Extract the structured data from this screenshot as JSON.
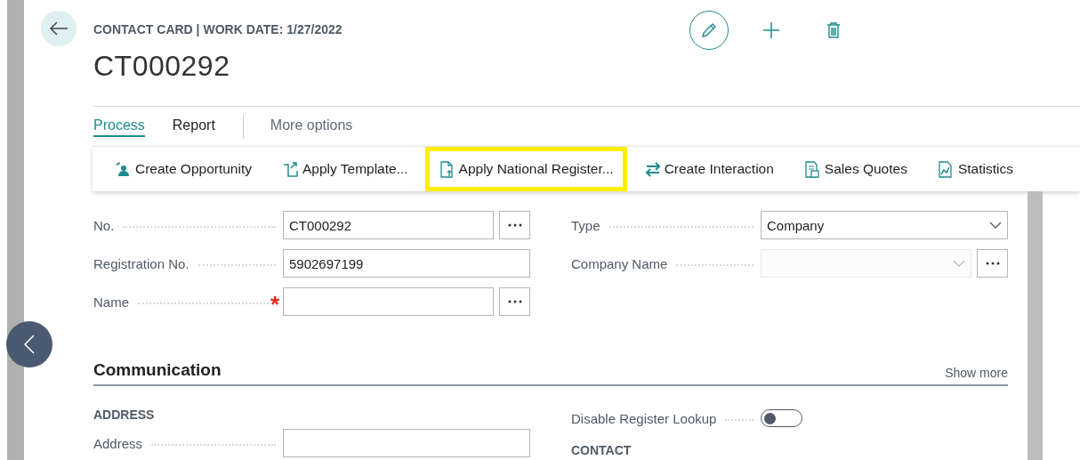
{
  "header": {
    "caption": "CONTACT CARD | WORK DATE: 1/27/2022",
    "title": "CT000292"
  },
  "tabs": [
    {
      "label": "Process",
      "selected": true
    },
    {
      "label": "Report",
      "selected": false
    },
    {
      "label": "More options",
      "selected": false,
      "kind": "more"
    }
  ],
  "actions": [
    {
      "label": "Create Opportunity",
      "kind": "opportunity",
      "highlighted": false
    },
    {
      "label": "Apply Template...",
      "kind": "template",
      "highlighted": false
    },
    {
      "label": "Apply National Register...",
      "kind": "register",
      "highlighted": true
    },
    {
      "label": "Create Interaction",
      "kind": "interaction",
      "highlighted": false
    },
    {
      "label": "Sales Quotes",
      "kind": "quotes",
      "highlighted": false
    },
    {
      "label": "Statistics",
      "kind": "statistics",
      "highlighted": false
    }
  ],
  "general": {
    "left": [
      {
        "label": "No.",
        "kind": "lookup",
        "value": "CT000292"
      },
      {
        "label": "Registration No.",
        "kind": "text",
        "value": "5902697199"
      },
      {
        "label": "Name",
        "kind": "lookup",
        "required_mark": "*"
      }
    ],
    "right": [
      {
        "label": "Type",
        "kind": "select",
        "value": "Company",
        "disabled": false
      },
      {
        "label": "Company Name",
        "kind": "select_lookup",
        "disabled": true
      }
    ]
  },
  "communication": {
    "title": "Communication",
    "show_more": "Show more",
    "left": {
      "group": "ADDRESS",
      "fields": [
        {
          "label": "Address",
          "kind": "text"
        }
      ]
    },
    "right": {
      "fields": [
        {
          "label": "Disable Register Lookup",
          "kind": "toggle",
          "on": false
        }
      ],
      "group": "CONTACT"
    }
  }
}
